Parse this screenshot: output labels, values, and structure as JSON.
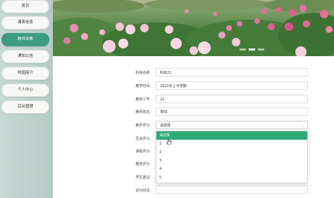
{
  "sidebar": {
    "items": [
      {
        "label": "首页",
        "active": false
      },
      {
        "label": "课表信息",
        "active": false
      },
      {
        "label": "教师评教",
        "active": true
      },
      {
        "label": "通知公告",
        "active": false
      },
      {
        "label": "校园简介",
        "active": false
      },
      {
        "label": "个人中心",
        "active": false
      },
      {
        "label": "后台管理",
        "active": false
      }
    ]
  },
  "banner": {
    "slide_count": 3,
    "active_slide": 2
  },
  "form": {
    "course_name_label": "科目名称:",
    "course_name_value": "科目22",
    "term_label": "教学时间:",
    "term_value": "2022年上半学期",
    "teacher_id_label": "教师工号:",
    "teacher_id_value": "22",
    "teacher_name_label": "教师姓名:",
    "teacher_name_value": "李四",
    "teaching_score_label": "教学评分:",
    "teaching_score_placeholder": "请选择",
    "interaction_label": "互动评分:",
    "classroom_label": "课程评分:",
    "overall_label": "整体评分:",
    "suggestion_label": "学生建议:",
    "eval_time_label": "评分时间:",
    "dropdown": {
      "options": [
        "请选择",
        "1",
        "2",
        "3",
        "4",
        "5"
      ],
      "highlighted": "请选择"
    }
  },
  "colors": {
    "accent": "#3e9c83",
    "option_highlight": "#2eaa75",
    "sidebar_bg": "#c2d4cf"
  }
}
